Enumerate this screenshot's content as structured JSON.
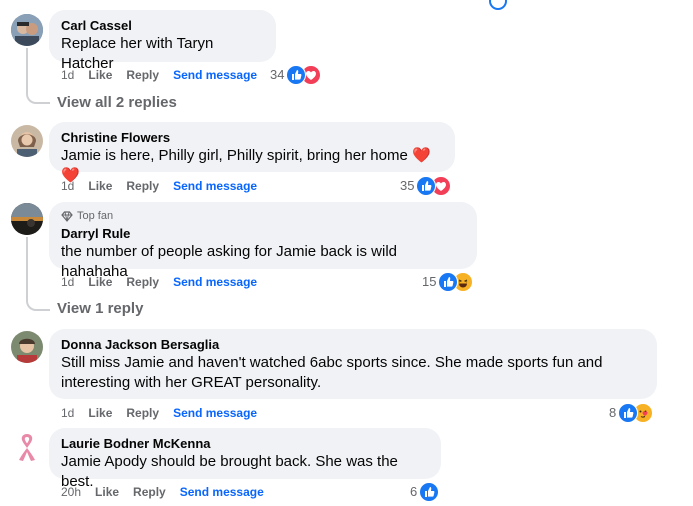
{
  "comments": [
    {
      "author": "Carl Cassel",
      "text": "Replace her with Taryn Hatcher",
      "time": "1d",
      "like": "Like",
      "reply": "Reply",
      "send": "Send message",
      "reaction_count": "34",
      "reactions": [
        "like-icon",
        "love-icon"
      ],
      "view_replies": "View all 2 replies"
    },
    {
      "author": "Christine Flowers",
      "text": "Jamie is here, Philly girl, Philly spirit, bring her home",
      "emoji": "❤️❤️",
      "time": "1d",
      "like": "Like",
      "reply": "Reply",
      "send": "Send message",
      "reaction_count": "35",
      "reactions": [
        "like-icon",
        "love-icon"
      ]
    },
    {
      "badge": "Top fan",
      "author": "Darryl Rule",
      "text": "the number of people asking for Jamie back is wild hahahaha",
      "time": "1d",
      "like": "Like",
      "reply": "Reply",
      "send": "Send message",
      "reaction_count": "15",
      "reactions": [
        "like-icon",
        "haha-icon"
      ],
      "view_replies": "View 1 reply"
    },
    {
      "author": "Donna Jackson Bersaglia",
      "text_line1": "Still miss Jamie and haven't watched 6abc sports since. She made sports fun and",
      "text_line2": "interesting with her GREAT personality.",
      "time": "1d",
      "like": "Like",
      "reply": "Reply",
      "send": "Send message",
      "reaction_count": "8",
      "reactions": [
        "like-icon",
        "care-icon"
      ]
    },
    {
      "author": "Laurie Bodner McKenna",
      "text": "Jamie Apody should be brought back. She was the best.",
      "time": "20h",
      "like": "Like",
      "reply": "Reply",
      "send": "Send message",
      "reaction_count": "6",
      "reactions": [
        "like-icon"
      ]
    }
  ],
  "colors": {
    "bubble": "#f0f2f5",
    "link": "#0866ff",
    "muted": "#65676b",
    "like": "#1877f2",
    "love": "#f33e58",
    "haha": "#f7b125"
  }
}
